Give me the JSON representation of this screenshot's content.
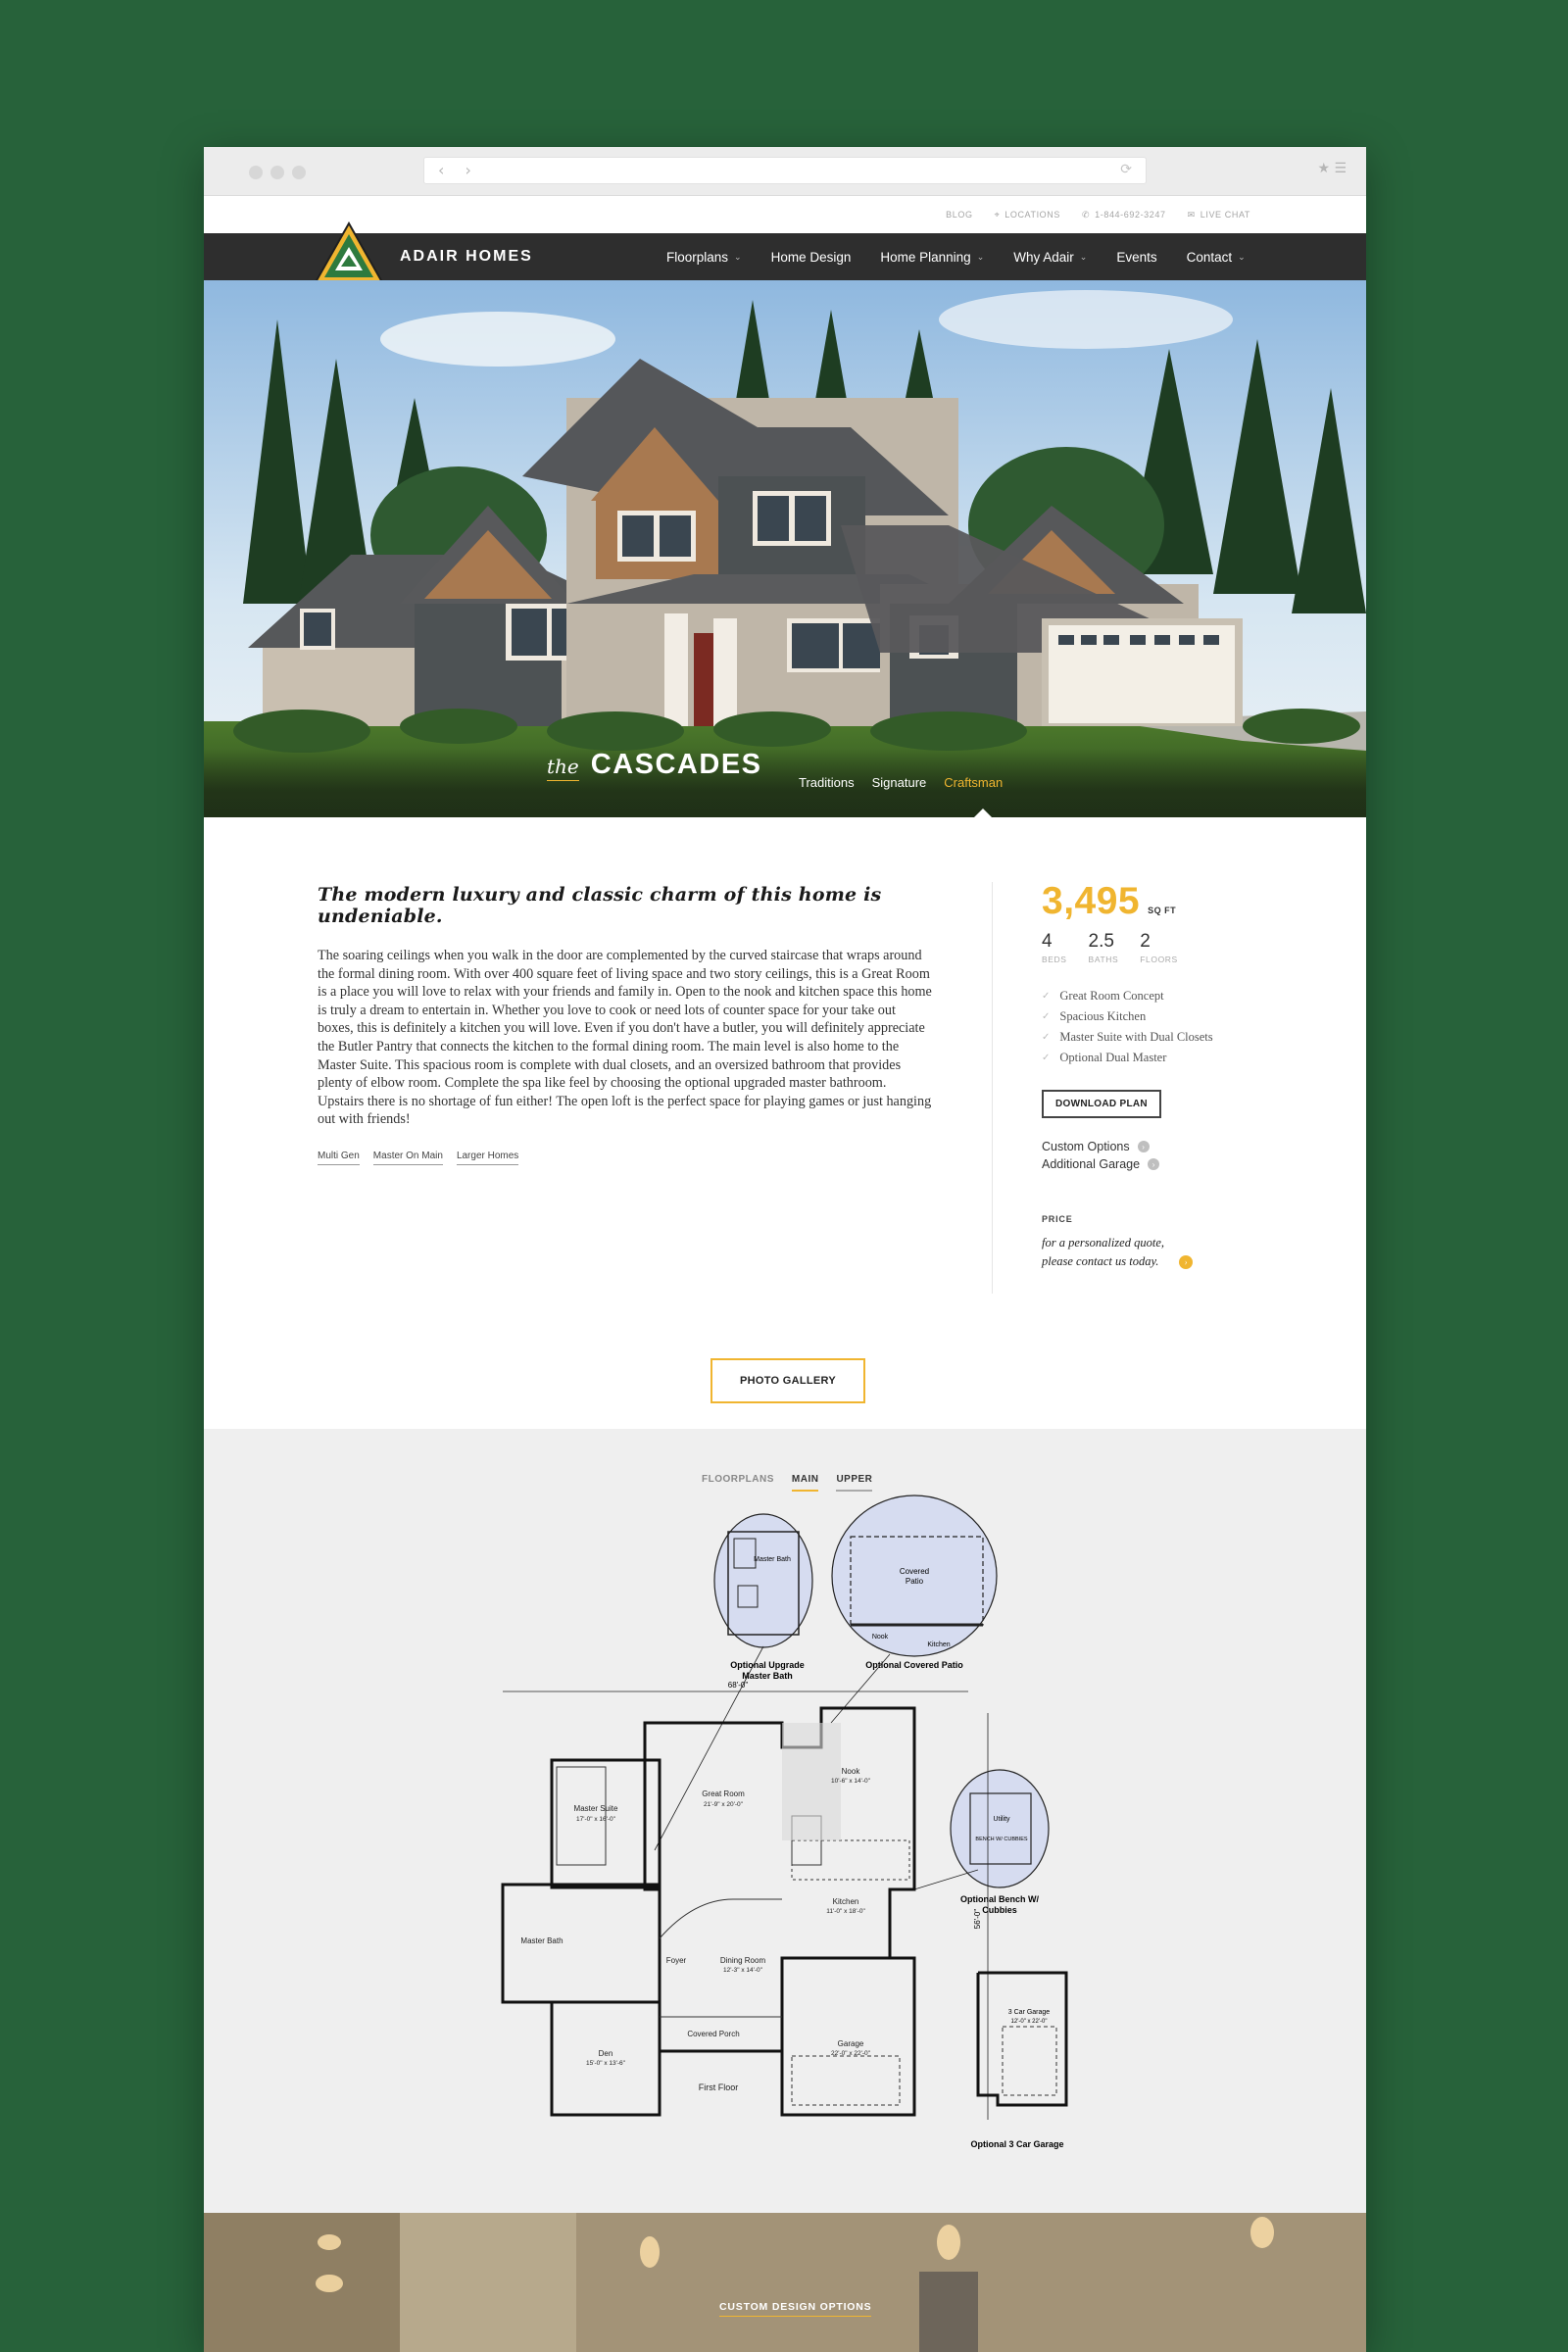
{
  "browser": {
    "nav_arrows": "‹ ›",
    "reload_glyph": "⟳",
    "tools_glyphs": "★ ☰"
  },
  "utility_nav": [
    {
      "label": "BLOG",
      "icon": ""
    },
    {
      "label": "LOCATIONS",
      "icon": "⌖"
    },
    {
      "label": "1-844-692-3247",
      "icon": "✆"
    },
    {
      "label": "LIVE CHAT",
      "icon": "✉"
    }
  ],
  "header": {
    "brand": "ADAIR HOMES",
    "menu": [
      {
        "label": "Floorplans",
        "chevron": "⌄"
      },
      {
        "label": "Home Design",
        "chevron": ""
      },
      {
        "label": "Home Planning",
        "chevron": "⌄"
      },
      {
        "label": "Why Adair",
        "chevron": "⌄"
      },
      {
        "label": "Events",
        "chevron": ""
      },
      {
        "label": "Contact",
        "chevron": "⌄"
      }
    ]
  },
  "hero": {
    "the": "the",
    "name": "CASCADES",
    "styles": [
      "Traditions",
      "Signature",
      "Craftsman"
    ],
    "active_style": "Craftsman"
  },
  "description": {
    "headline": "The modern luxury and classic charm of this home is undeniable.",
    "body": "The soaring ceilings when you walk in the door are complemented by the curved staircase that wraps around the formal dining room. With over 400 square feet of living space and two story ceilings, this is a Great Room is a place you will love to relax with your friends and family in. Open to the nook and kitchen space this home is truly a dream to entertain in. Whether you love to cook or need lots of counter space for your take out boxes, this is definitely a kitchen you will love. Even if you don't have a butler, you will definitely appreciate the Butler Pantry that connects the kitchen to the formal dining room. The main level is also home to the Master Suite. This spacious room is complete with dual closets, and an oversized bathroom that provides plenty of elbow room. Complete the spa like feel by choosing the optional upgraded master bathroom. Upstairs there is no shortage of fun either! The open loft is the perfect space for playing games or just hanging out with friends!",
    "tags": [
      "Multi Gen",
      "Master On Main",
      "Larger Homes"
    ]
  },
  "specs": {
    "sqft": "3,495",
    "sqft_unit": "SQ FT",
    "stats": [
      {
        "value": "4",
        "label": "BEDS"
      },
      {
        "value": "2.5",
        "label": "BATHS"
      },
      {
        "value": "2",
        "label": "FLOORS"
      }
    ],
    "features": [
      "Great Room Concept",
      "Spacious Kitchen",
      "Master Suite with Dual Closets",
      "Optional Dual Master"
    ],
    "check_glyph": "✓",
    "download_label": "DOWNLOAD PLAN",
    "options": [
      "Custom Options",
      "Additional Garage"
    ],
    "option_glyph": "›",
    "price_label": "PRICE",
    "price_line1": "for a personalized quote,",
    "price_line2": "please contact us today.",
    "price_glyph": "›"
  },
  "gallery_label": "PHOTO GALLERY",
  "floorplans": {
    "label": "FLOORPLANS",
    "tabs": [
      "MAIN",
      "UPPER"
    ],
    "active_tab": "MAIN",
    "callouts": {
      "upgrade_bath_1": "Optional Upgrade",
      "upgrade_bath_2": "Master Bath",
      "covered_patio": "Optional Covered Patio",
      "bench": "Optional Bench W/",
      "bench_2": "Cubbies",
      "garage3": "Optional 3 Car Garage"
    },
    "rooms": {
      "master_bath_inset": "Master Bath",
      "covered_patio_1": "Covered",
      "covered_patio_2": "Patio",
      "nook_inset": "Nook",
      "kitchen_inset": "Kitchen",
      "utility_inset": "Utility",
      "bench_inset": "BENCH W/ CUBBIES",
      "master_suite": "Master Suite",
      "master_suite_dim": "17'-0\" x 16'-0\"",
      "great_room": "Great Room",
      "great_room_dim": "21'-9\" x 20'-0\"",
      "nook": "Nook",
      "nook_dim": "10'-6\" x 14'-0\"",
      "kitchen": "Kitchen",
      "kitchen_dim": "11'-0\" x 18'-0\"",
      "master_bath": "Master Bath",
      "foyer": "Foyer",
      "dining": "Dining Room",
      "dining_dim": "12'-3\" x 14'-0\"",
      "covered_porch": "Covered Porch",
      "den": "Den",
      "den_dim": "15'-0\" x 13'-6\"",
      "garage": "Garage",
      "garage_dim": "22'-0\" x 22'-0\"",
      "garage3": "3 Car Garage",
      "garage3_dim": "12'-0\" x 22'-0\"",
      "first_floor": "First Floor",
      "width": "68'-0\"",
      "depth": "56'-0\""
    }
  },
  "custom_label": "CUSTOM DESIGN OPTIONS",
  "colors": {
    "background": "#27623a",
    "accent": "#f0b530",
    "nav": "#2e2e2e"
  }
}
